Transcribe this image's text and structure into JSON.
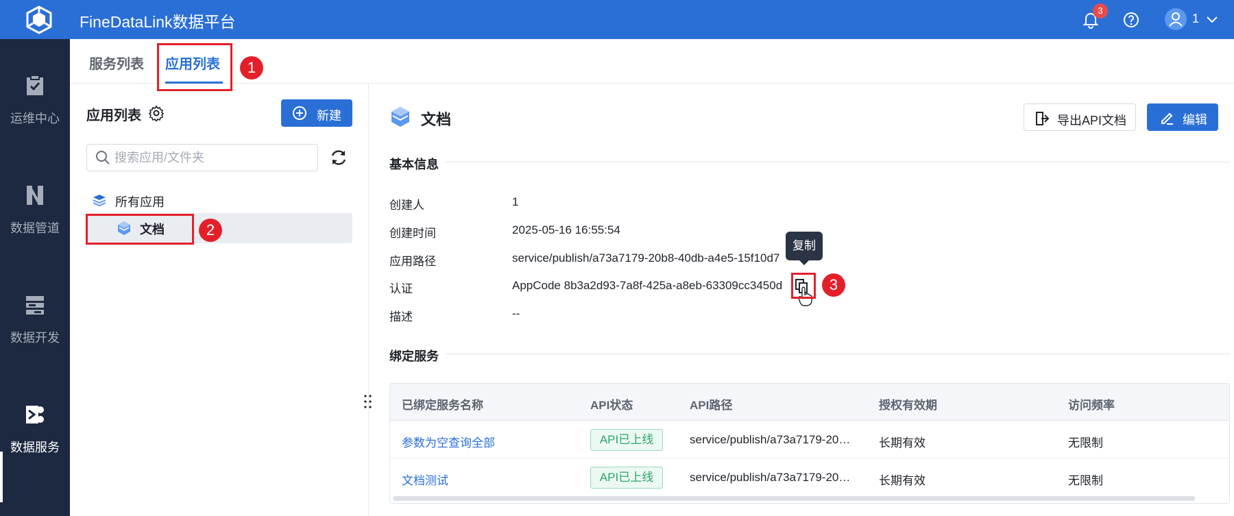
{
  "app": {
    "title": "FineDataLink数据平台",
    "notification_count": "3",
    "user_name": "1"
  },
  "colors": {
    "brand": "#2a6fd6",
    "nav_bg": "#1c2940",
    "annotation_red": "#e3202a",
    "status_green": "#2aa66b"
  },
  "nav": {
    "items": [
      {
        "label": "运维中心",
        "icon": "clipboard-check-icon"
      },
      {
        "label": "数据管道",
        "icon": "pipeline-icon"
      },
      {
        "label": "数据开发",
        "icon": "development-icon"
      },
      {
        "label": "数据服务",
        "icon": "data-service-icon"
      }
    ]
  },
  "tabs": [
    {
      "label": "服务列表"
    },
    {
      "label": "应用列表"
    }
  ],
  "annotations": [
    "1",
    "2",
    "3"
  ],
  "left_panel": {
    "title": "应用列表",
    "new_button": "新建",
    "search_placeholder": "搜索应用/文件夹",
    "tree": {
      "root": "所有应用",
      "selected": "文档"
    }
  },
  "detail": {
    "title": "文档",
    "export_button": "导出API文档",
    "edit_button": "编辑",
    "basic_info_title": "基本信息",
    "fields": [
      {
        "label": "创建人",
        "value": "1"
      },
      {
        "label": "创建时间",
        "value": "2025-05-16 16:55:54"
      },
      {
        "label": "应用路径",
        "value": "service/publish/a73a7179-20b8-40db-a4e5-15f10d7"
      },
      {
        "label": "认证",
        "value": "AppCode 8b3a2d93-7a8f-425a-a8eb-63309cc3450d"
      },
      {
        "label": "描述",
        "value": "--"
      }
    ],
    "copy_tooltip": "复制",
    "bound_services_title": "绑定服务"
  },
  "table": {
    "headers": [
      "已绑定服务名称",
      "API状态",
      "API路径",
      "授权有效期",
      "访问频率"
    ],
    "rows": [
      {
        "name": "参数为空查询全部",
        "status": "API已上线",
        "path": "service/publish/a73a7179-20…",
        "validity": "长期有效",
        "rate": "无限制"
      },
      {
        "name": "文档测试",
        "status": "API已上线",
        "path": "service/publish/a73a7179-20…",
        "validity": "长期有效",
        "rate": "无限制"
      }
    ]
  }
}
